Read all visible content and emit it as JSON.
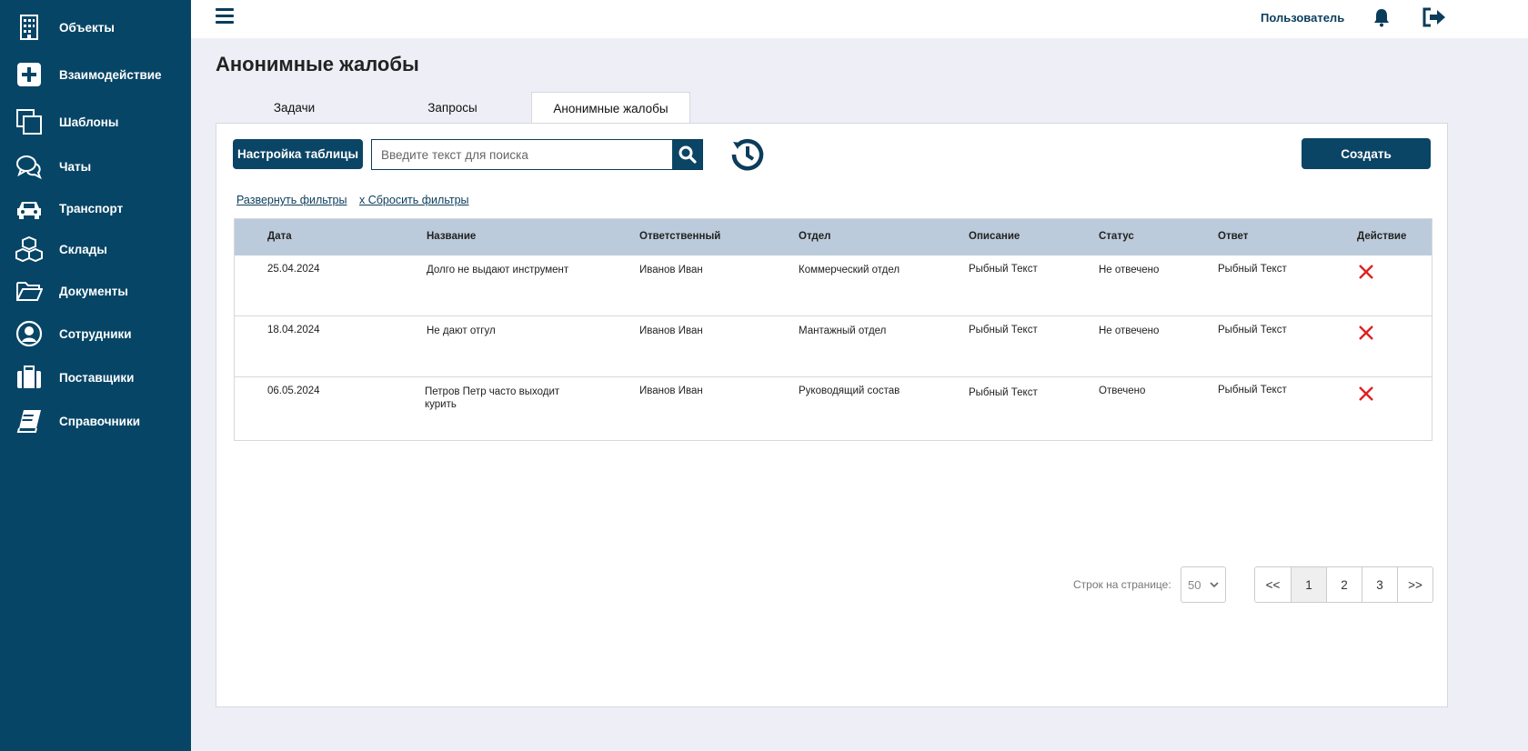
{
  "sidebar": {
    "items": [
      {
        "label": "Объекты",
        "icon": "building-icon"
      },
      {
        "label": "Взаимодействие",
        "icon": "plus-square-icon"
      },
      {
        "label": "Шаблоны",
        "icon": "copy-icon"
      },
      {
        "label": "Чаты",
        "icon": "chat-icon"
      },
      {
        "label": "Транспорт",
        "icon": "car-icon"
      },
      {
        "label": "Склады",
        "icon": "boxes-icon"
      },
      {
        "label": "Документы",
        "icon": "folder-icon"
      },
      {
        "label": "Сотрудники",
        "icon": "user-circle-icon"
      },
      {
        "label": "Поставщики",
        "icon": "briefcase-icon"
      },
      {
        "label": "Справочники",
        "icon": "book-icon"
      }
    ]
  },
  "header": {
    "user_label": "Пользователь"
  },
  "page": {
    "title": "Анонимные жалобы",
    "tabs": [
      {
        "label": "Задачи"
      },
      {
        "label": "Запросы"
      },
      {
        "label": "Анонимные жалобы",
        "active": true
      }
    ]
  },
  "toolbar": {
    "settings_label": "Настройка таблицы",
    "search_placeholder": "Введите текст для поиска",
    "create_label": "Создать"
  },
  "filters": {
    "expand_label": "Развернуть фильтры",
    "reset_label": "x Сбросить фильтры"
  },
  "table": {
    "columns": [
      "Дата",
      "Название",
      "Ответственный",
      "Отдел",
      "Описание",
      "Статус",
      "Ответ",
      "Действие"
    ],
    "rows": [
      [
        "25.04.2024",
        "Долго не выдают инструмент",
        "Иванов Иван",
        "Коммерческий отдел",
        "Рыбный Текст",
        "Не отвечено",
        "Рыбный Текст"
      ],
      [
        "18.04.2024",
        "Не дают отгул",
        "Иванов Иван",
        "Мантажный отдел",
        "Рыбный Текст",
        "Не отвечено",
        "Рыбный Текст"
      ],
      [
        "06.05.2024",
        "Петров Петр часто выходит курить",
        "Иванов Иван",
        "Руководящий состав",
        "Рыбный Текст",
        "Отвечено",
        "Рыбный Текст"
      ]
    ]
  },
  "pagination": {
    "rows_label": "Строк на странице:",
    "rows_value": "50",
    "pages": [
      "<<",
      "1",
      "2",
      "3",
      ">>"
    ],
    "current_page": "1"
  },
  "colors": {
    "sidebar": "#064566",
    "accent": "#0b4566",
    "header_row": "#bccbdb",
    "delete": "#e02020"
  }
}
